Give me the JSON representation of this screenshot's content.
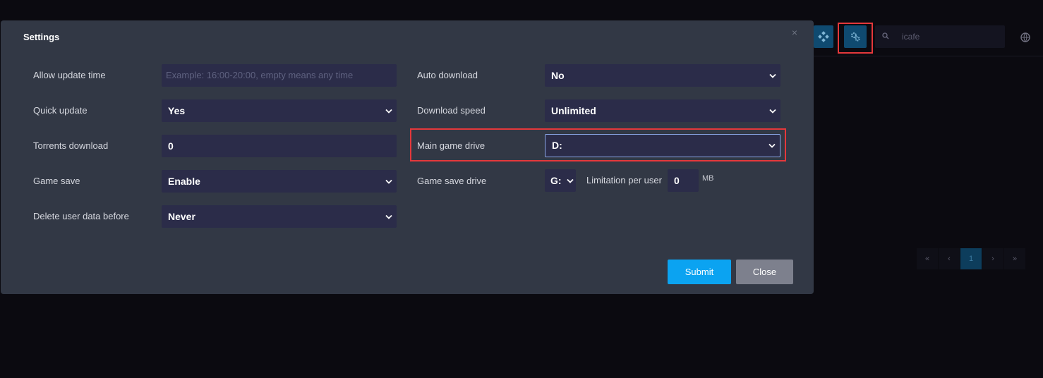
{
  "background": {
    "search": {
      "value": "icafe"
    },
    "pagination": [
      "«",
      "‹",
      "1",
      "›",
      "»"
    ],
    "icons": [
      "tiles-icon",
      "gears-icon",
      "search-icon",
      "globe-icon"
    ]
  },
  "modal": {
    "title": "Settings",
    "close_glyph": "×",
    "left": [
      {
        "label": "Allow update time",
        "value": "",
        "placeholder": "Example: 16:00-20:00, empty means any time",
        "type": "text"
      },
      {
        "label": "Quick update",
        "value": "Yes",
        "type": "select"
      },
      {
        "label": "Torrents download",
        "value": "0",
        "type": "text"
      },
      {
        "label": "Game save",
        "value": "Enable",
        "type": "select"
      },
      {
        "label": "Delete user data before",
        "value": "Never",
        "type": "select"
      }
    ],
    "right": [
      {
        "label": "Auto download",
        "value": "No",
        "type": "select"
      },
      {
        "label": "Download speed",
        "value": "Unlimited",
        "type": "select"
      },
      {
        "label": "Main game drive",
        "value": "D:",
        "type": "select"
      },
      {
        "label": "Game save drive",
        "value": "G:",
        "type": "select"
      }
    ],
    "limitation": {
      "label": "Limitation per user",
      "value": "0",
      "unit": "MB"
    },
    "buttons": {
      "submit": "Submit",
      "close": "Close"
    }
  },
  "colors": {
    "accent": "#0ba3f1",
    "highlight": "#e5383b",
    "modal_bg": "#323845",
    "field_bg": "#2b2c49"
  }
}
